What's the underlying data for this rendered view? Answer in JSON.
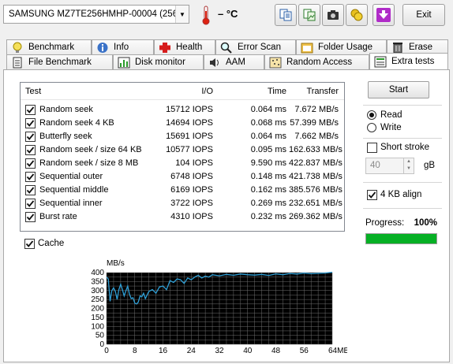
{
  "toolbar": {
    "drive": "SAMSUNG MZ7TE256HMHP-00004 (256",
    "temperature": "– °C",
    "exit_label": "Exit",
    "buttons": [
      "copy-text-icon",
      "copy-image-icon",
      "screenshot-camera-icon",
      "options-coins-icon",
      "save-down-arrow-icon"
    ]
  },
  "tabs_row1": [
    {
      "label": "Benchmark",
      "icon": "lightbulb-icon"
    },
    {
      "label": "Info",
      "icon": "info-icon"
    },
    {
      "label": "Health",
      "icon": "health-cross-icon"
    },
    {
      "label": "Error Scan",
      "icon": "magnifier-icon"
    },
    {
      "label": "Folder Usage",
      "icon": "folder-icon"
    },
    {
      "label": "Erase",
      "icon": "trash-icon"
    }
  ],
  "tabs_row2": [
    {
      "label": "File Benchmark",
      "icon": "document-icon"
    },
    {
      "label": "Disk monitor",
      "icon": "bar-chart-icon"
    },
    {
      "label": "AAM",
      "icon": "speaker-icon"
    },
    {
      "label": "Random Access",
      "icon": "dots-grid-icon"
    },
    {
      "label": "Extra tests",
      "icon": "extra-tests-icon"
    }
  ],
  "table": {
    "headers": {
      "test": "Test",
      "io": "I/O",
      "time": "Time",
      "transfer": "Transfer"
    },
    "rows": [
      {
        "name": "Random seek",
        "io": "15712 IOPS",
        "time": "0.064 ms",
        "transfer": "7.672 MB/s"
      },
      {
        "name": "Random seek 4 KB",
        "io": "14694 IOPS",
        "time": "0.068 ms",
        "transfer": "57.399 MB/s"
      },
      {
        "name": "Butterfly seek",
        "io": "15691 IOPS",
        "time": "0.064 ms",
        "transfer": "7.662 MB/s"
      },
      {
        "name": "Random seek / size 64 KB",
        "io": "10577 IOPS",
        "time": "0.095 ms",
        "transfer": "162.633 MB/s"
      },
      {
        "name": "Random seek / size 8 MB",
        "io": "104 IOPS",
        "time": "9.590 ms",
        "transfer": "422.837 MB/s"
      },
      {
        "name": "Sequential outer",
        "io": "6748 IOPS",
        "time": "0.148 ms",
        "transfer": "421.738 MB/s"
      },
      {
        "name": "Sequential middle",
        "io": "6169 IOPS",
        "time": "0.162 ms",
        "transfer": "385.576 MB/s"
      },
      {
        "name": "Sequential inner",
        "io": "3722 IOPS",
        "time": "0.269 ms",
        "transfer": "232.651 MB/s"
      },
      {
        "name": "Burst rate",
        "io": "4310 IOPS",
        "time": "0.232 ms",
        "transfer": "269.362 MB/s"
      }
    ]
  },
  "cache_label": "Cache",
  "controls": {
    "start_label": "Start",
    "read_label": "Read",
    "write_label": "Write",
    "short_stroke_label": "Short stroke",
    "stroke_value": "40",
    "stroke_unit": "gB",
    "align_label": "4 KB align",
    "progress_label": "Progress:",
    "progress_value": "100%",
    "progress_fraction": 1.0
  },
  "chart_data": {
    "type": "line",
    "ylabel": "MB/s",
    "xunit": "MB",
    "ylim": [
      0,
      400
    ],
    "xlim": [
      0,
      64
    ],
    "yticks": [
      "400",
      "350",
      "300",
      "250",
      "200",
      "150",
      "100",
      "50",
      "0"
    ],
    "xticks": [
      "0",
      "8",
      "16",
      "24",
      "32",
      "40",
      "48",
      "56",
      "64MB"
    ],
    "grid": true,
    "colors": {
      "background": "#000000",
      "grid": "#6e6e6e",
      "line": "#2e9fd6"
    },
    "x": [
      0,
      0.5,
      1,
      1.5,
      2,
      2.5,
      3,
      3.5,
      4,
      4.5,
      5,
      5.5,
      6,
      6.5,
      7,
      7.5,
      8,
      8.5,
      9,
      9.5,
      10,
      10.5,
      11,
      12,
      13,
      14,
      15,
      16,
      17,
      18,
      19,
      20,
      21,
      22,
      23,
      24,
      25,
      26,
      27,
      28,
      29,
      30,
      32,
      34,
      36,
      38,
      40,
      42,
      44,
      46,
      48,
      50,
      52,
      54,
      56,
      58,
      60,
      62,
      64
    ],
    "y": [
      375,
      365,
      240,
      300,
      315,
      295,
      250,
      305,
      335,
      305,
      270,
      300,
      325,
      280,
      255,
      260,
      230,
      225,
      235,
      270,
      265,
      285,
      255,
      295,
      305,
      285,
      320,
      325,
      305,
      355,
      345,
      365,
      360,
      340,
      370,
      360,
      375,
      385,
      370,
      380,
      375,
      388,
      382,
      390,
      385,
      392,
      388,
      386,
      390,
      384,
      393,
      388,
      395,
      392,
      398,
      394,
      396,
      398,
      402
    ]
  }
}
